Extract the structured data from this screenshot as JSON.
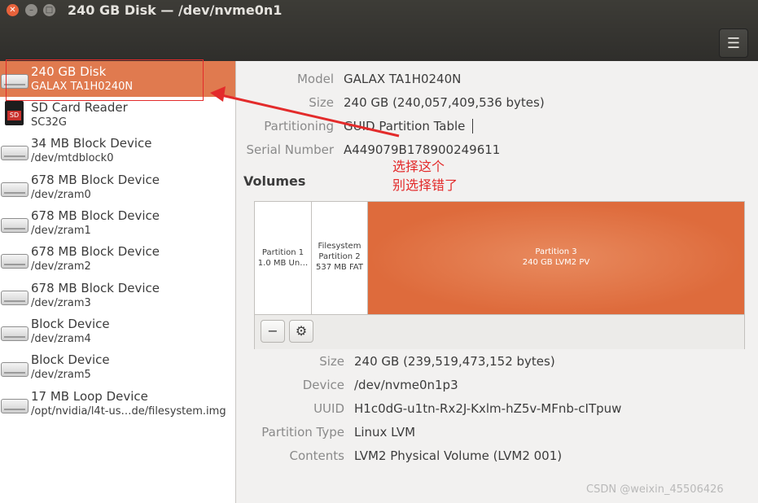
{
  "window": {
    "title": "240 GB Disk — /dev/nvme0n1",
    "close_glyph": "✕",
    "min_glyph": "–",
    "max_glyph": "□",
    "menu_glyph": "☰"
  },
  "devices": [
    {
      "name": "240 GB Disk",
      "sub": "GALAX TA1H0240N",
      "icon": "hdd-icon",
      "selected": true
    },
    {
      "name": "SD Card Reader",
      "sub": "SC32G",
      "icon": "sd-card-icon"
    },
    {
      "name": "34 MB Block Device",
      "sub": "/dev/mtdblock0",
      "icon": "drive-icon"
    },
    {
      "name": "678 MB Block Device",
      "sub": "/dev/zram0",
      "icon": "drive-icon"
    },
    {
      "name": "678 MB Block Device",
      "sub": "/dev/zram1",
      "icon": "drive-icon"
    },
    {
      "name": "678 MB Block Device",
      "sub": "/dev/zram2",
      "icon": "drive-icon"
    },
    {
      "name": "678 MB Block Device",
      "sub": "/dev/zram3",
      "icon": "drive-icon"
    },
    {
      "name": "Block Device",
      "sub": "/dev/zram4",
      "icon": "drive-icon"
    },
    {
      "name": "Block Device",
      "sub": "/dev/zram5",
      "icon": "drive-icon"
    },
    {
      "name": "17 MB Loop Device",
      "sub": "/opt/nvidia/l4t-us…de/filesystem.img",
      "icon": "drive-icon"
    }
  ],
  "sd_label": "SD",
  "disk": {
    "model_label": "Model",
    "model": "GALAX TA1H0240N",
    "size_label": "Size",
    "size": "240 GB (240,057,409,536 bytes)",
    "partitioning_label": "Partitioning",
    "partitioning": "GUID Partition Table",
    "serial_label": "Serial Number",
    "serial": "A449079B178900249611"
  },
  "volumes": {
    "heading": "Volumes",
    "partitions": [
      {
        "line1": "Partition 1",
        "line2": "1.0 MB Un…"
      },
      {
        "line0": "Filesystem",
        "line1": "Partition 2",
        "line2": "537 MB FAT"
      },
      {
        "line1": "Partition 3",
        "line2": "240 GB LVM2 PV"
      }
    ],
    "remove_glyph": "−",
    "settings_glyph": "⚙"
  },
  "volume_details": {
    "size_label": "Size",
    "size": "240 GB (239,519,473,152 bytes)",
    "device_label": "Device",
    "device": "/dev/nvme0n1p3",
    "uuid_label": "UUID",
    "uuid": "H1c0dG-u1tn-Rx2J-Kxlm-hZ5v-MFnb-cITpuw",
    "ptype_label": "Partition Type",
    "ptype": "Linux LVM",
    "contents_label": "Contents",
    "contents": "LVM2 Physical Volume (LVM2 001)"
  },
  "annotation": {
    "line1": "选择这个",
    "line2": "别选择错了",
    "color": "#e32b2b"
  },
  "watermark": "CSDN @weixin_45506426"
}
